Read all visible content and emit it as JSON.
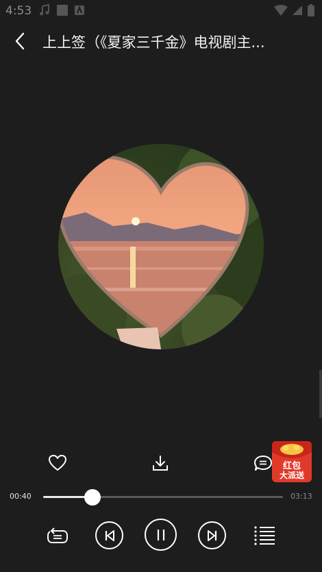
{
  "status": {
    "time": "4:53"
  },
  "header": {
    "title": "上上签（《夏家三千金》电视剧主..."
  },
  "red_packet": {
    "line1": "红包",
    "line2": "大派送"
  },
  "player": {
    "current_time": "00:40",
    "total_time": "03:13",
    "progress": 0.207
  },
  "icons": {
    "back": "chevron-left-icon",
    "like": "heart-icon",
    "download": "download-icon",
    "comment": "comment-icon",
    "repeat": "repeat-mode-icon",
    "prev": "previous-track-icon",
    "play_pause": "pause-icon",
    "next": "next-track-icon",
    "playlist": "playlist-icon"
  },
  "colors": {
    "background": "#1d1d1d",
    "accent": "#ffffff",
    "red_packet": "#e23a2a"
  }
}
